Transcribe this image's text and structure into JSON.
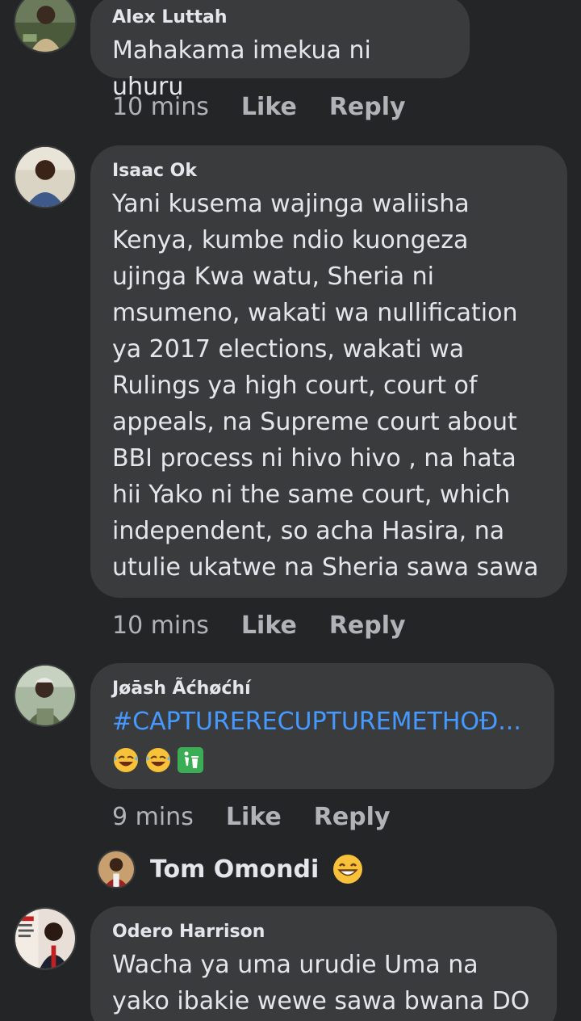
{
  "comments": [
    {
      "author": "Alex Luttah",
      "text": "Mahakama imekua ni uhuru",
      "time": "10 mins",
      "like": "Like",
      "reply": "Reply"
    },
    {
      "author": "Isaac Ok",
      "text": "Yani kusema wajinga waliisha Kenya, kumbe ndio kuongeza ujinga Kwa watu, Sheria ni msumeno, wakati wa nullification ya 2017 elections, wakati wa Rulings ya high court, court of appeals, na Supreme court about BBI process ni hivo hivo , na hata hii Yako ni the same court, which independent, so acha Hasira, na utulie ukatwe na Sheria sawa sawa",
      "time": "10 mins",
      "like": "Like",
      "reply": "Reply"
    },
    {
      "author": "Jøāsh Ãćhøćhí",
      "text": "#CAPTURERECUPTUREMETHOĐ...",
      "emojis": [
        "rolling-laughing-emoji",
        "rolling-laughing-emoji",
        "litter-bin-emoji"
      ],
      "time": "9 mins",
      "like": "Like",
      "reply": "Reply",
      "reply_preview": {
        "author": "Tom Omondi",
        "emoji": "grinning-face-emoji"
      }
    },
    {
      "author": "Odero Harrison",
      "text": "Wacha ya uma urudie Uma na yako ibakie wewe sawa bwana DO"
    }
  ],
  "colors": {
    "background": "#242526",
    "bubble": "#3a3b3c",
    "text": "#e4e6eb",
    "muted": "#b0b3b8",
    "link": "#4599ff"
  }
}
